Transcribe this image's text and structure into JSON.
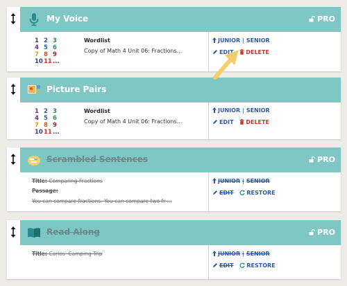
{
  "colors": {
    "header_bg": "#7fc7c5",
    "background": "#ecebe6",
    "link_blue": "#2c5aa0",
    "delete_red": "#c0392b",
    "arrow_yellow": "#f5cd6b"
  },
  "cards": [
    {
      "title": "My Voice",
      "icon": "microphone-icon",
      "pro_label": "PRO",
      "wordlist_label": "Wordlist",
      "wordlist_value": "Copy of Math 4 Unit 06: Fractions...",
      "levels": [
        "JUNIOR",
        "SENIOR"
      ],
      "edit_label": "EDIT",
      "delete_label": "DELETE"
    },
    {
      "title": "Picture Pairs",
      "icon": "picture-pairs-icon",
      "pro_label": "",
      "wordlist_label": "Wordlist",
      "wordlist_value": "Copy of Math 4 Unit 06: Fractions...",
      "levels": [
        "JUNIOR",
        "SENIOR"
      ],
      "edit_label": "EDIT",
      "delete_label": "DELETE"
    },
    {
      "title": "Scrambled Sentences",
      "icon": "scrambled-sentences-icon",
      "pro_label": "PRO",
      "title_label": "Title:",
      "title_value": "Comparing Fractions",
      "passage_label": "Passage:",
      "passage_value": "You can compare fractions. You can compare two fr ...",
      "levels": [
        "JUNIOR",
        "SENIOR"
      ],
      "edit_label": "EDIT",
      "restore_label": "RESTORE"
    },
    {
      "title": "Read Along",
      "icon": "book-icon",
      "pro_label": "PRO",
      "title_label": "Title:",
      "title_value": "Carlos' Camping Trip",
      "levels": [
        "JUNIOR",
        "SENIOR"
      ],
      "edit_label": "EDIT",
      "restore_label": "RESTORE"
    }
  ],
  "numbers_grid": [
    [
      {
        "n": "1",
        "c": "#6a2a8a"
      },
      {
        "n": "2",
        "c": "#2c5aa0"
      },
      {
        "n": "3",
        "c": "#2e8b57"
      }
    ],
    [
      {
        "n": "4",
        "c": "#6a2a8a"
      },
      {
        "n": "5",
        "c": "#2c5aa0"
      },
      {
        "n": "6",
        "c": "#2e8b57"
      }
    ],
    [
      {
        "n": "7",
        "c": "#d4a020"
      },
      {
        "n": "8",
        "c": "#c85a20"
      },
      {
        "n": "9",
        "c": "#8a2a2a"
      }
    ],
    [
      {
        "n": "10",
        "c": "#2c3a9a"
      },
      {
        "n": "11",
        "c": "#c0392b"
      },
      {
        "n": "...",
        "c": "#2c3a9a"
      }
    ]
  ]
}
